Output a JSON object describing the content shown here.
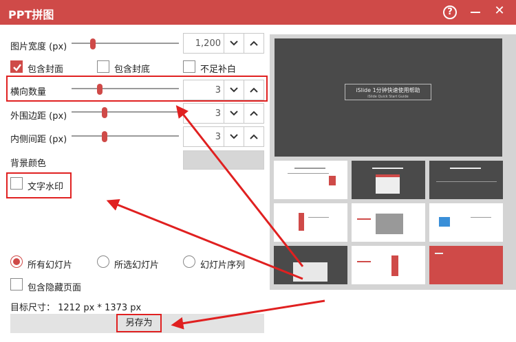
{
  "window": {
    "title": "PPT拼图",
    "help_label": "?",
    "close_label": "✕"
  },
  "settings": {
    "width": {
      "label": "图片宽度 (px)",
      "value": "1,200",
      "slider_level": 0.2
    },
    "columns": {
      "label": "横向数量",
      "value": "3",
      "slider_level": 0.3
    },
    "outer_margin": {
      "label": "外围边距 (px)",
      "value": "3",
      "slider_level": 0.35
    },
    "inner_margin": {
      "label": "内侧间距 (px)",
      "value": "3",
      "slider_level": 0.35
    },
    "bg_color": {
      "label": "背景颜色",
      "value": "#d6d6d6"
    }
  },
  "options": {
    "include_cover": {
      "label": "包含封面",
      "checked": true
    },
    "include_back": {
      "label": "包含封底",
      "checked": false
    },
    "pad_blank": {
      "label": "不足补白",
      "checked": false
    },
    "watermark": {
      "label": "文字水印",
      "checked": false
    },
    "include_hidden": {
      "label": "包含隐藏页面",
      "checked": false
    }
  },
  "scope": {
    "all": "所有幻灯片",
    "selected": "所选幻灯片",
    "sequence": "幻灯片序列",
    "selected_option": "all"
  },
  "target_size": "目标尺寸： 1212 px *  1373 px",
  "save_as_label": "另存为",
  "preview": {
    "main_title": "iSlide 1分钟快速使用帮助",
    "main_subtitle": "iSlide Quick Start Guide"
  },
  "colors": {
    "accent": "#cf4a48",
    "annotation": "#e02020",
    "preview_bg": "#d4d4d4"
  }
}
